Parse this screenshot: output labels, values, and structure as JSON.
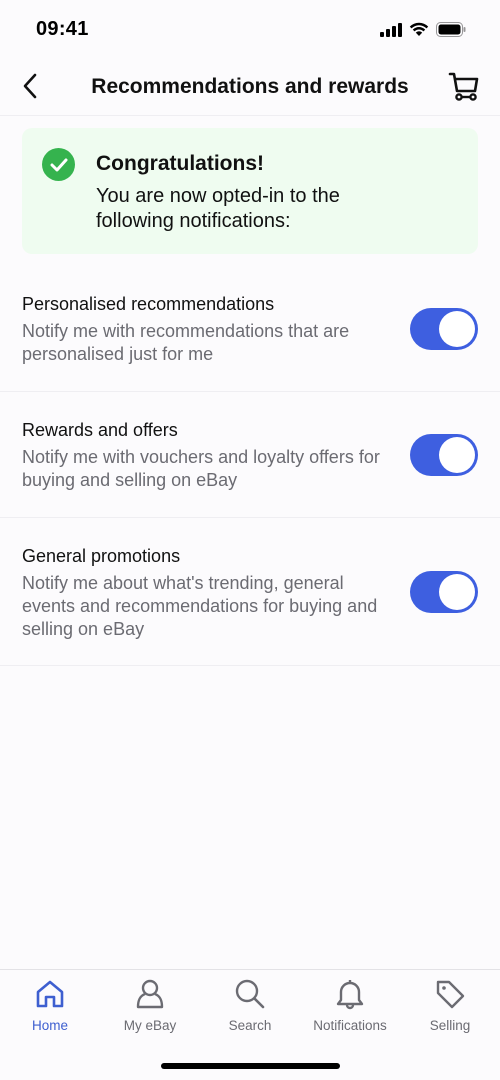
{
  "status_bar": {
    "time": "09:41",
    "icons": [
      "signal-icon",
      "wifi-icon",
      "battery-icon"
    ]
  },
  "header": {
    "title": "Recommendations and rewards",
    "back_icon": "chevron-left-icon",
    "cart_icon": "cart-icon"
  },
  "banner": {
    "icon": "check-circle-icon",
    "title": "Congratulations!",
    "text": "You are now opted-in to the following notifications:",
    "accent_color": "#35b34e",
    "background": "#effcf0"
  },
  "settings": [
    {
      "title": "Personalised recommendations",
      "description": "Notify me with recommendations that are personalised just for me",
      "enabled": true
    },
    {
      "title": "Rewards and offers",
      "description": "Notify me with vouchers and loyalty offers for buying and selling on eBay",
      "enabled": true
    },
    {
      "title": "General promotions",
      "description": "Notify me about what's trending, general events and recommendations for buying and selling on eBay",
      "enabled": true
    }
  ],
  "toggle_color": "#3e5fe0",
  "tabbar": {
    "active": "Home",
    "active_color": "#3e5fd0",
    "items": [
      {
        "label": "Home",
        "icon": "home-icon"
      },
      {
        "label": "My eBay",
        "icon": "user-icon"
      },
      {
        "label": "Search",
        "icon": "search-icon"
      },
      {
        "label": "Notifications",
        "icon": "bell-icon"
      },
      {
        "label": "Selling",
        "icon": "tag-icon"
      }
    ]
  }
}
